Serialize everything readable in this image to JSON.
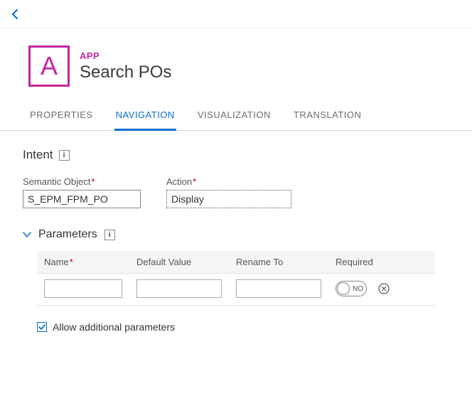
{
  "header": {
    "type_label": "APP",
    "title": "Search POs",
    "tile_letter": "A"
  },
  "tabs": [
    {
      "label": "PROPERTIES",
      "active": false
    },
    {
      "label": "NAVIGATION",
      "active": true
    },
    {
      "label": "VISUALIZATION",
      "active": false
    },
    {
      "label": "TRANSLATION",
      "active": false
    }
  ],
  "intent": {
    "section_label": "Intent",
    "semantic_object": {
      "label": "Semantic Object",
      "value": "S_EPM_FPM_PO"
    },
    "action": {
      "label": "Action",
      "value": "Display"
    }
  },
  "parameters": {
    "section_label": "Parameters",
    "columns": {
      "name": "Name",
      "default": "Default Value",
      "rename": "Rename To",
      "required": "Required"
    },
    "rows": [
      {
        "name": "",
        "default": "",
        "rename": "",
        "required_label": "NO"
      }
    ],
    "allow_additional_label": "Allow additional parameters",
    "allow_additional_checked": true
  }
}
